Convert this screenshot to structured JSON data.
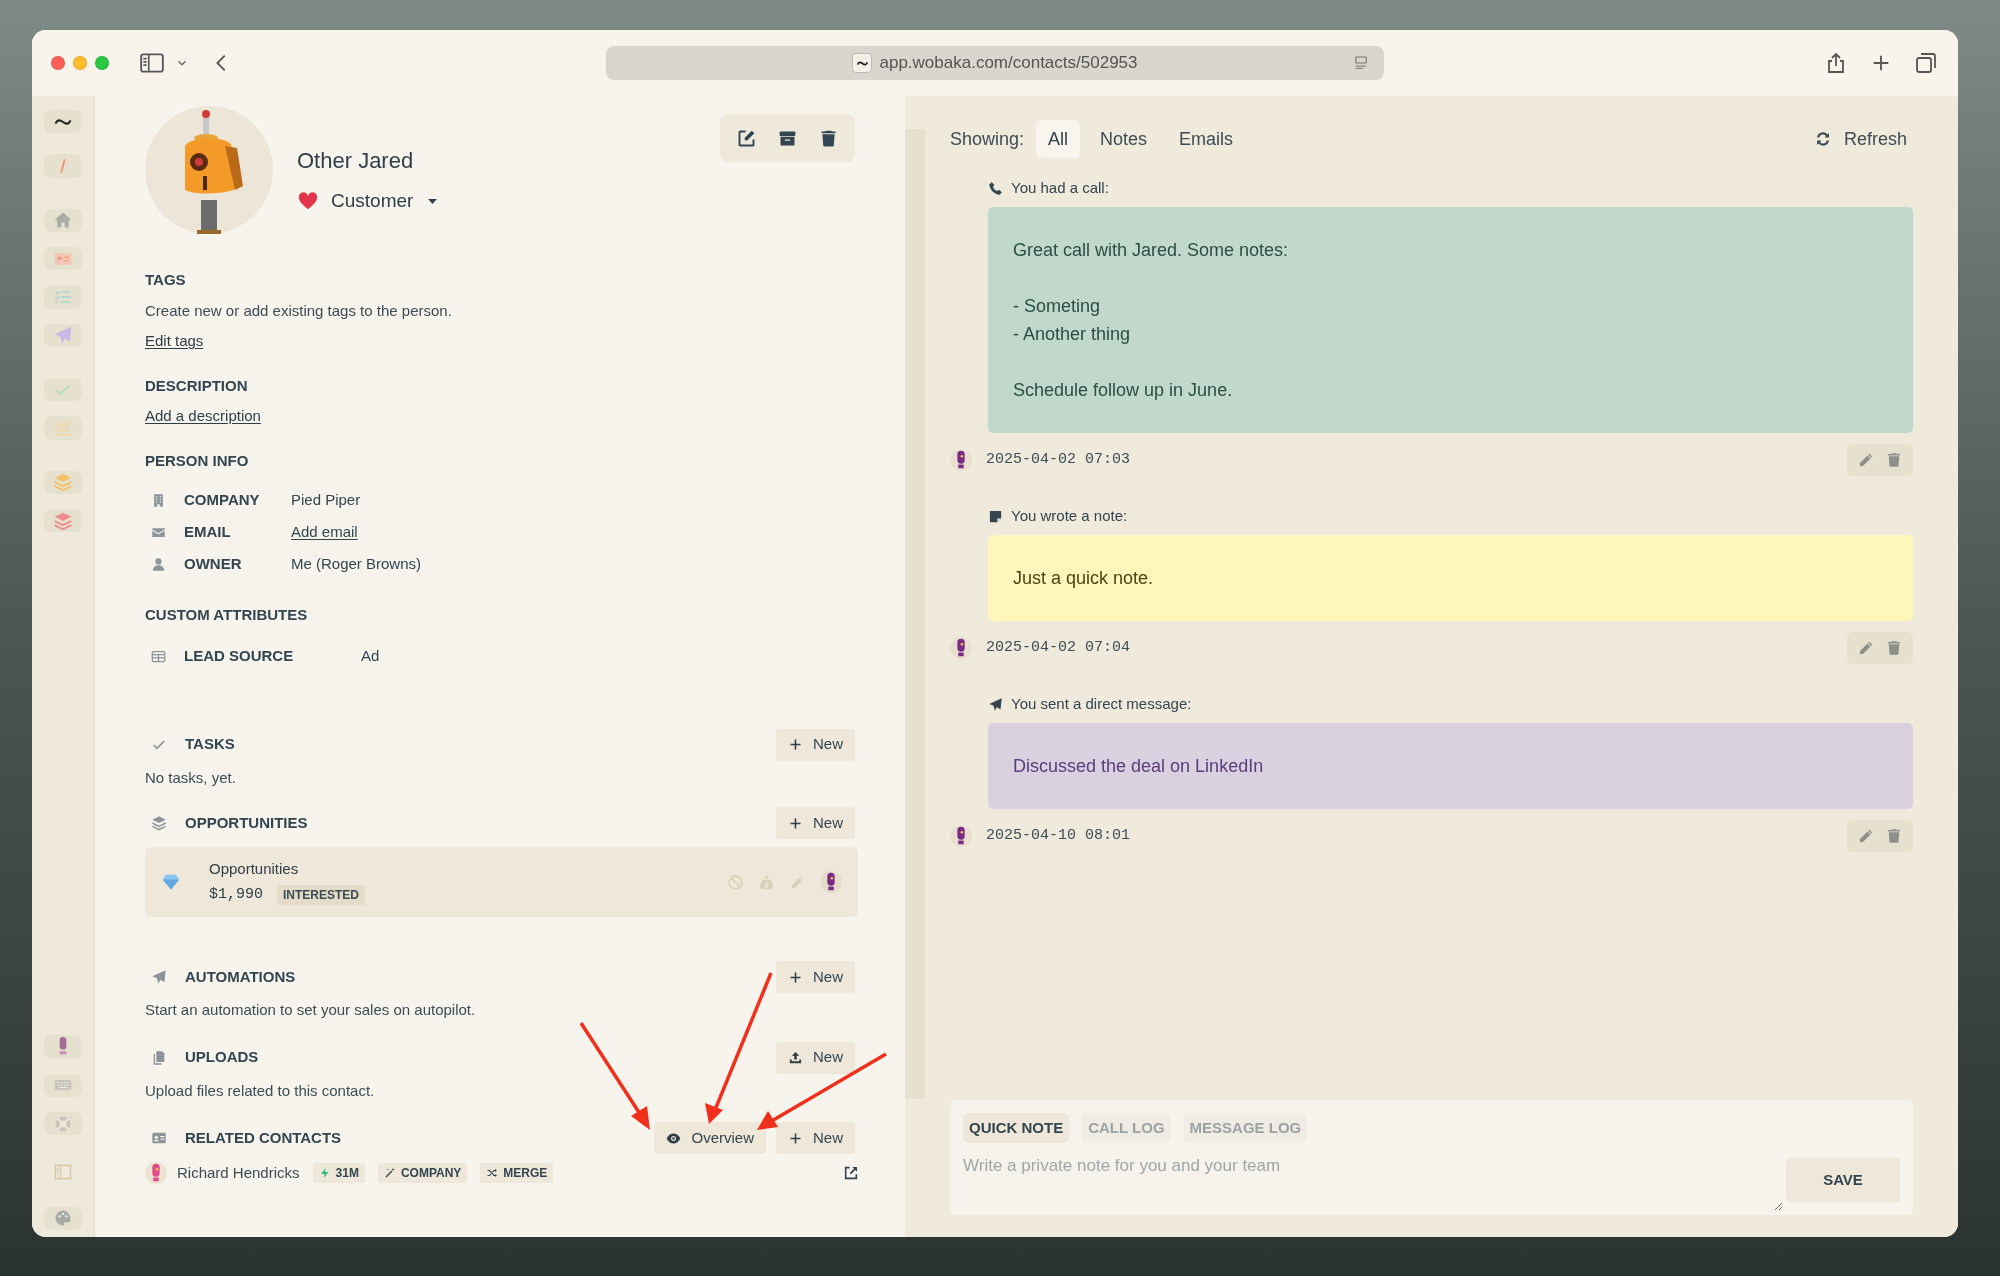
{
  "browser": {
    "url": "app.wobaka.com/contacts/502953"
  },
  "contact": {
    "name": "Other Jared",
    "status": "Customer"
  },
  "tags": {
    "title": "TAGS",
    "text": "Create new or add existing tags to the person.",
    "link": "Edit tags"
  },
  "description": {
    "title": "DESCRIPTION",
    "link": "Add a description"
  },
  "person_info": {
    "title": "PERSON INFO",
    "fields": [
      {
        "kind": "company",
        "label": "COMPANY",
        "value": "Pied Piper",
        "link": false
      },
      {
        "kind": "email",
        "label": "EMAIL",
        "value": "Add email",
        "link": true
      },
      {
        "kind": "owner",
        "label": "OWNER",
        "value": "Me (Roger Browns)",
        "link": false
      }
    ]
  },
  "custom_attributes": {
    "title": "CUSTOM ATTRIBUTES",
    "fields": [
      {
        "label": "LEAD SOURCE",
        "value": "Ad"
      }
    ]
  },
  "tasks": {
    "title": "TASKS",
    "button": "New",
    "text": "No tasks, yet."
  },
  "opportunities": {
    "title": "OPPORTUNITIES",
    "button": "New",
    "items": [
      {
        "name": "Opportunities",
        "amount": "$1,990",
        "stage": "INTERESTED"
      }
    ]
  },
  "automations": {
    "title": "AUTOMATIONS",
    "button": "New",
    "text": "Start an automation to set your sales on autopilot."
  },
  "uploads": {
    "title": "UPLOADS",
    "button": "New",
    "text": "Upload files related to this contact."
  },
  "related_contacts": {
    "title": "RELATED CONTACTS",
    "buttons": [
      "Overview",
      "New"
    ],
    "items": [
      {
        "name": "Richard Hendricks",
        "tags": [
          {
            "kind": "bolt",
            "label": "31M"
          },
          {
            "kind": "wand",
            "label": "COMPANY"
          },
          {
            "kind": "shuffle",
            "label": "MERGE"
          }
        ]
      }
    ]
  },
  "activity": {
    "label": "Showing:",
    "filters": [
      {
        "label": "All",
        "selected": true
      },
      {
        "label": "Notes",
        "selected": false
      },
      {
        "label": "Emails",
        "selected": false
      }
    ],
    "refresh": "Refresh",
    "entries": [
      {
        "kind": "call",
        "heading": "You had a call:",
        "body": [
          "Great call with Jared. Some notes:",
          "- Someting\n- Another thing",
          "Schedule follow up in June."
        ],
        "timestamp": "2025-04-02 07:03"
      },
      {
        "kind": "note",
        "heading": "You wrote a note:",
        "body": [
          "Just a quick note."
        ],
        "timestamp": "2025-04-02 07:04"
      },
      {
        "kind": "message",
        "heading": "You sent a direct message:",
        "body": [
          "Discussed the deal on LinkedIn"
        ],
        "timestamp": "2025-04-10 08:01"
      }
    ]
  },
  "composer": {
    "tabs": [
      {
        "label": "QUICK NOTE",
        "selected": true
      },
      {
        "label": "CALL LOG",
        "selected": false
      },
      {
        "label": "MESSAGE LOG",
        "selected": false
      }
    ],
    "placeholder": "Write a private note for you and your team",
    "save": "SAVE"
  }
}
